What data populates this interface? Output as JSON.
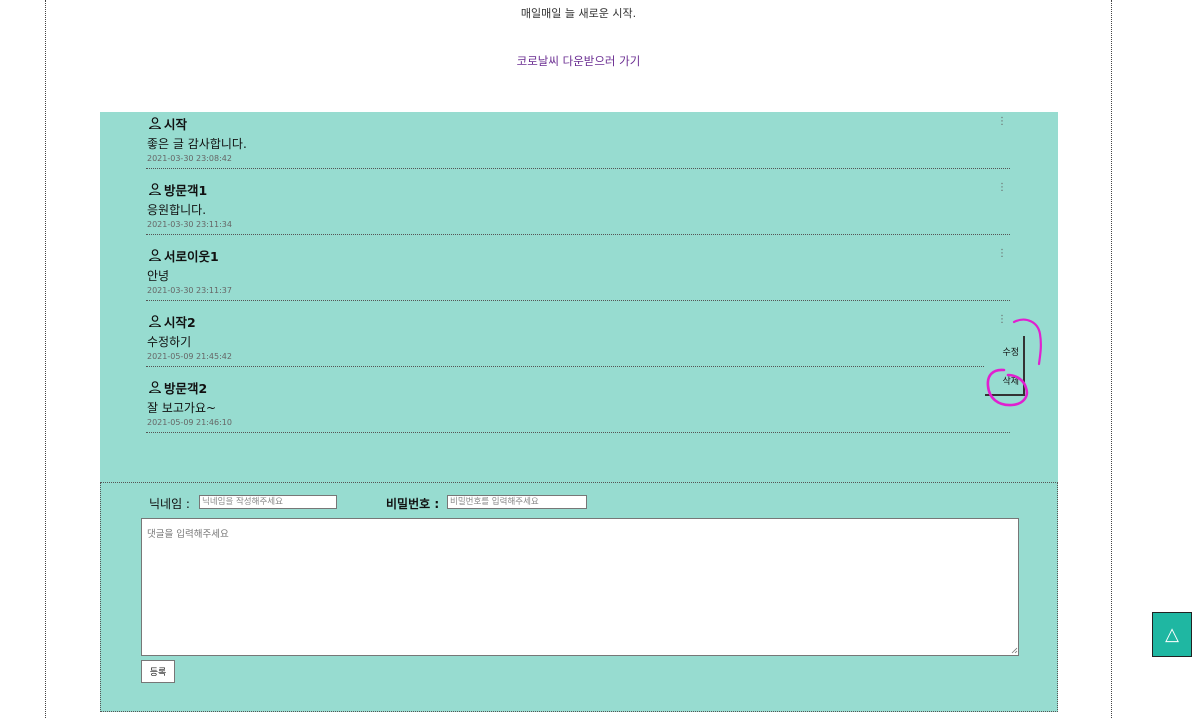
{
  "header": {
    "subtitle": "매일매일 늘 새로운 시작.",
    "download_link": "코로날씨 다운받으러 가기"
  },
  "comments": [
    {
      "author": "시작",
      "body": "좋은 글 감사합니다.",
      "date": "2021-03-30 23:08:42",
      "more": "⋮"
    },
    {
      "author": "방문객1",
      "body": "응원합니다.",
      "date": "2021-03-30 23:11:34",
      "more": "⋮"
    },
    {
      "author": "서로이웃1",
      "body": "안녕",
      "date": "2021-03-30 23:11:37",
      "more": "⋮"
    },
    {
      "author": "시작2",
      "body": "수정하기",
      "date": "2021-05-09 21:45:42",
      "more": "⋮"
    },
    {
      "author": "방문객2",
      "body": "잘 보고가요~",
      "date": "2021-05-09 21:46:10",
      "more": ""
    }
  ],
  "menu": {
    "edit": "수정",
    "delete": "삭제"
  },
  "form": {
    "nickname_label": "닉네임 :",
    "nickname_placeholder": "닉네임을 작성해주세요",
    "password_label": "비밀번호 :",
    "password_placeholder": "비밀번호를 입력해주세요",
    "comment_placeholder": "댓글을 입력해주세요",
    "submit_label": "등록"
  },
  "top_button": {
    "symbol": "△"
  },
  "colors": {
    "panel": "#97dcd0",
    "link": "#6a2c91",
    "annotation": "#e020d0",
    "top_button": "#1fb7a2"
  }
}
